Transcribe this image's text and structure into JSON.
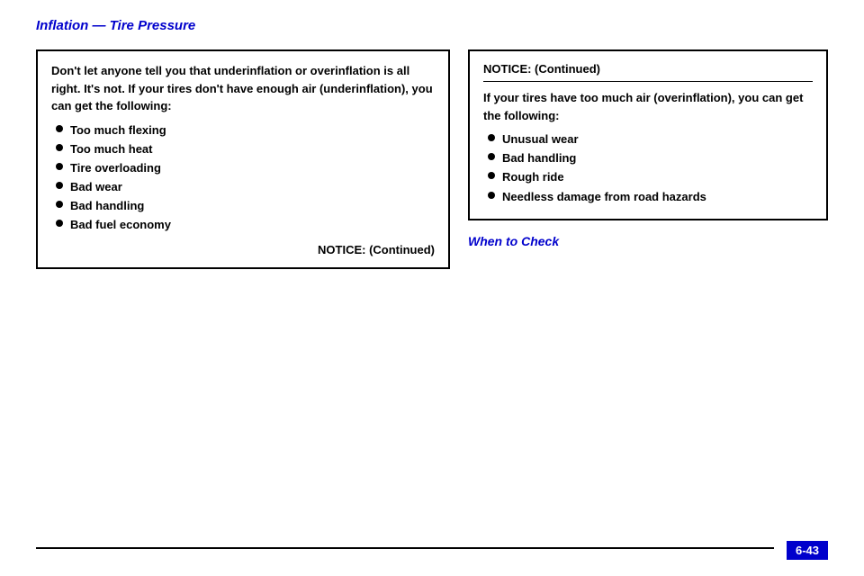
{
  "page": {
    "title": "Inflation — Tire Pressure",
    "page_number": "6-43"
  },
  "left_column": {
    "notice_box": {
      "header": "Don't let anyone tell you that underinflation or overinflation is all right. It's not. If your tires don't have enough air (underinflation), you can get the following:",
      "items": [
        "Too much flexing",
        "Too much heat",
        "Tire overloading",
        "Bad wear",
        "Bad handling",
        "Bad fuel economy"
      ],
      "continued": "NOTICE: (Continued)"
    }
  },
  "right_column": {
    "notice_continued_box": {
      "header": "NOTICE: (Continued)",
      "intro": "If your tires have too much air (overinflation), you can get the following:",
      "items": [
        "Unusual wear",
        "Bad handling",
        "Rough ride",
        "Needless damage from road hazards"
      ]
    },
    "when_to_check": {
      "title": "When to Check"
    }
  }
}
